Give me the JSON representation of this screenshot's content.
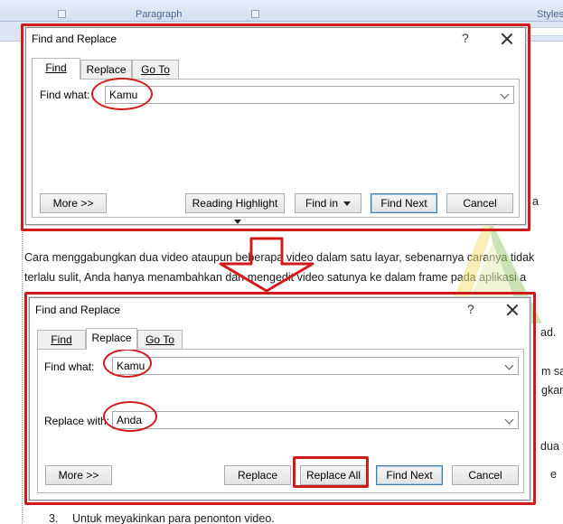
{
  "ribbon": {
    "paragraph_label": "Paragraph",
    "styles_label": "Styles"
  },
  "document": {
    "fragment_top": "a",
    "line1": "Cara menggabungkan dua video ataupun beberapa video dalam satu layar,  sebenarnya caranya tidak",
    "line2": "terlalu sulit, Anda hanya menambahkan dan mengedit video satunya ke dalam frame pada aplikasi a",
    "side_fragments": [
      "ad.",
      "m sa",
      "gkan",
      "dua v",
      "e",
      "r",
      "a"
    ],
    "list_number": "3.",
    "list_text": "Untuk meyakinkan para penonton video."
  },
  "dialog_find": {
    "title": "Find and Replace",
    "help": "?",
    "tabs": [
      "Find",
      "Replace",
      "Go To"
    ],
    "active_tab": "Find",
    "find_label": "Find what:",
    "find_value": "Kamu",
    "buttons": {
      "more": "More >>",
      "reading_highlight": "Reading Highlight",
      "find_in": "Find in",
      "find_next": "Find Next",
      "cancel": "Cancel"
    }
  },
  "dialog_replace": {
    "title": "Find and Replace",
    "help": "?",
    "tabs": [
      "Find",
      "Replace",
      "Go To"
    ],
    "active_tab": "Replace",
    "find_label": "Find what:",
    "find_value": "Kamu",
    "replace_label": "Replace with:",
    "replace_value": "Anda",
    "buttons": {
      "more": "More >>",
      "replace": "Replace",
      "replace_all": "Replace All",
      "find_next": "Find Next",
      "cancel": "Cancel"
    }
  },
  "colors": {
    "annotation_red": "#d11a1a",
    "default_button_border": "#3c7fb1",
    "ribbon_bg": "#dbe5f3"
  }
}
